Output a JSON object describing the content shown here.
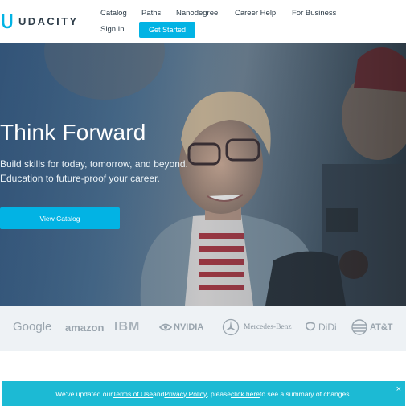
{
  "brand": {
    "name": "UDACITY",
    "accent": "#02b3e4"
  },
  "nav": {
    "items": [
      {
        "label": "Catalog"
      },
      {
        "label": "Paths"
      },
      {
        "label": "Nanodegree"
      },
      {
        "label": "Career Help"
      },
      {
        "label": "For Business"
      }
    ],
    "sign_in": "Sign In",
    "get_started": "Get Started"
  },
  "hero": {
    "title": "Think Forward",
    "subtitle_line1": "Build skills for today, tomorrow, and beyond.",
    "subtitle_line2": "Education to future-proof your career.",
    "cta": "View Catalog"
  },
  "partners": [
    {
      "name": "Google",
      "icon": ""
    },
    {
      "name": "amazon",
      "icon": ""
    },
    {
      "name": "IBM",
      "icon": ""
    },
    {
      "name": "NVIDIA",
      "icon": "nvidia-eye-icon"
    },
    {
      "name": "Mercedes-Benz",
      "icon": "mercedes-star-icon"
    },
    {
      "name": "DiDi",
      "icon": "didi-logo-icon"
    },
    {
      "name": "AT&T",
      "icon": "att-globe-icon"
    }
  ],
  "notice": {
    "prefix": "We've updated our ",
    "terms": "Terms of Use",
    "and": " and ",
    "privacy": "Privacy Policy",
    "mid": " , please ",
    "click_here": "click here",
    "suffix": " to see a summary of changes.",
    "close": "×"
  }
}
